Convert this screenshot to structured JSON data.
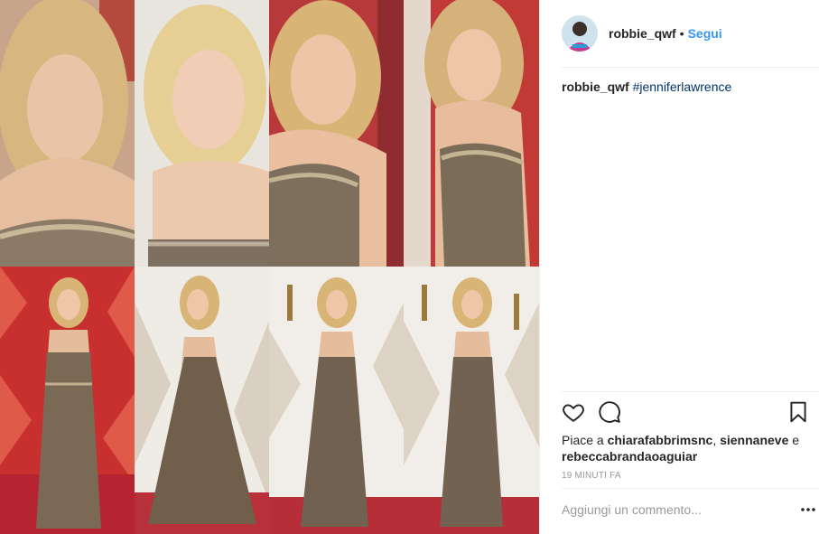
{
  "post": {
    "username": "robbie_qwf",
    "separator": "•",
    "follow_label": "Segui",
    "caption": {
      "username": "robbie_qwf",
      "hashtag": "#jenniferlawrence"
    },
    "likes": {
      "prefix": "Piace a ",
      "users": [
        "chiarafabbrimsnc",
        "siennaneve",
        "rebeccabrandaoaguiar"
      ],
      "sep1": ", ",
      "and": " e "
    },
    "timestamp": "19 MINUTI FA",
    "comment_placeholder": "Aggiungi un commento..."
  },
  "icons": {
    "like": "heart-icon",
    "comment": "comment-icon",
    "save": "bookmark-icon",
    "more": "more-options-icon"
  },
  "colors": {
    "accent": "#3897f0",
    "hashtag": "#003569",
    "text": "#262626",
    "muted": "#999999",
    "divider": "#efefef"
  }
}
